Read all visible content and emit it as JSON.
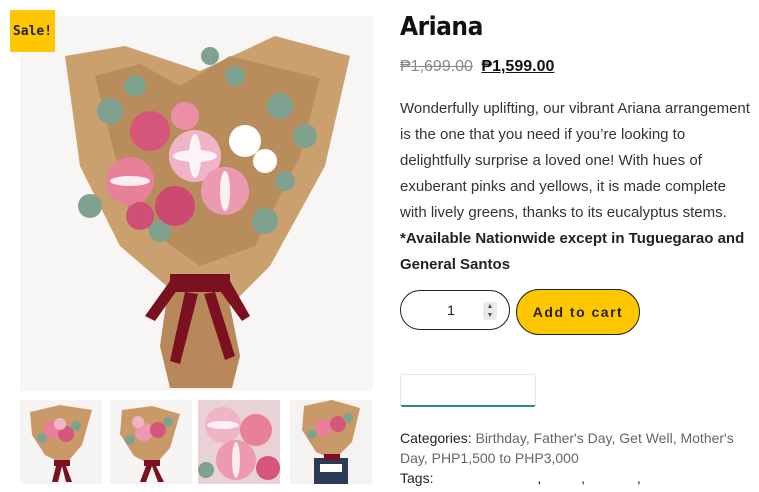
{
  "badge": {
    "label": "Sale!"
  },
  "product": {
    "title": "Ariana",
    "old_price": "₱1,699.00",
    "new_price": "₱1,599.00",
    "description": "Wonderfully uplifting, our vibrant Ariana arrangement is the one that you need if you’re looking to delightfully surprise a loved one! With hues of exuberant pinks and yellows, it is made complete with lively greens, thanks to its eucalyptus stems.",
    "availability_note": "*Available Nationwide except in Tuguegarao and General Santos"
  },
  "cart": {
    "quantity": "1",
    "add_label": "Add to cart"
  },
  "meta": {
    "categories_label": "Categories:",
    "categories": [
      "Birthday",
      "Father's Day",
      "Get Well",
      "Mother's Day",
      "PHP1,500 to PHP3,000"
    ],
    "tags_label": "Tags:"
  },
  "gallery": {
    "thumbnails": [
      "bouquet-front",
      "bouquet-side",
      "lily-closeup",
      "bouquet-held"
    ]
  },
  "colors": {
    "accent": "#ffc700",
    "ribbon": "#7b1020",
    "paper": "#c99a68",
    "lily_pink": "#e8809a"
  }
}
